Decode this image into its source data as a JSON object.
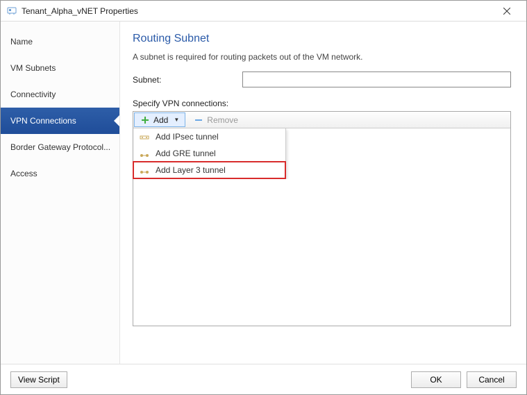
{
  "title": "Tenant_Alpha_vNET Properties",
  "nav": [
    {
      "label": "Name"
    },
    {
      "label": "VM Subnets"
    },
    {
      "label": "Connectivity"
    },
    {
      "label": "VPN Connections",
      "selected": true
    },
    {
      "label": "Border Gateway Protocol..."
    },
    {
      "label": "Access"
    }
  ],
  "main": {
    "heading": "Routing Subnet",
    "description": "A subnet is required for routing packets out of the VM network.",
    "subnet_label": "Subnet:",
    "subnet_value": "",
    "specify_label": "Specify VPN connections:",
    "toolbar": {
      "add": "Add",
      "remove": "Remove"
    },
    "dropdown": [
      {
        "label": "Add IPsec tunnel",
        "icon": "ipsec"
      },
      {
        "label": "Add GRE tunnel",
        "icon": "gre"
      },
      {
        "label": "Add Layer 3 tunnel",
        "icon": "l3",
        "highlight": true
      }
    ]
  },
  "footer": {
    "view_script": "View Script",
    "ok": "OK",
    "cancel": "Cancel"
  }
}
